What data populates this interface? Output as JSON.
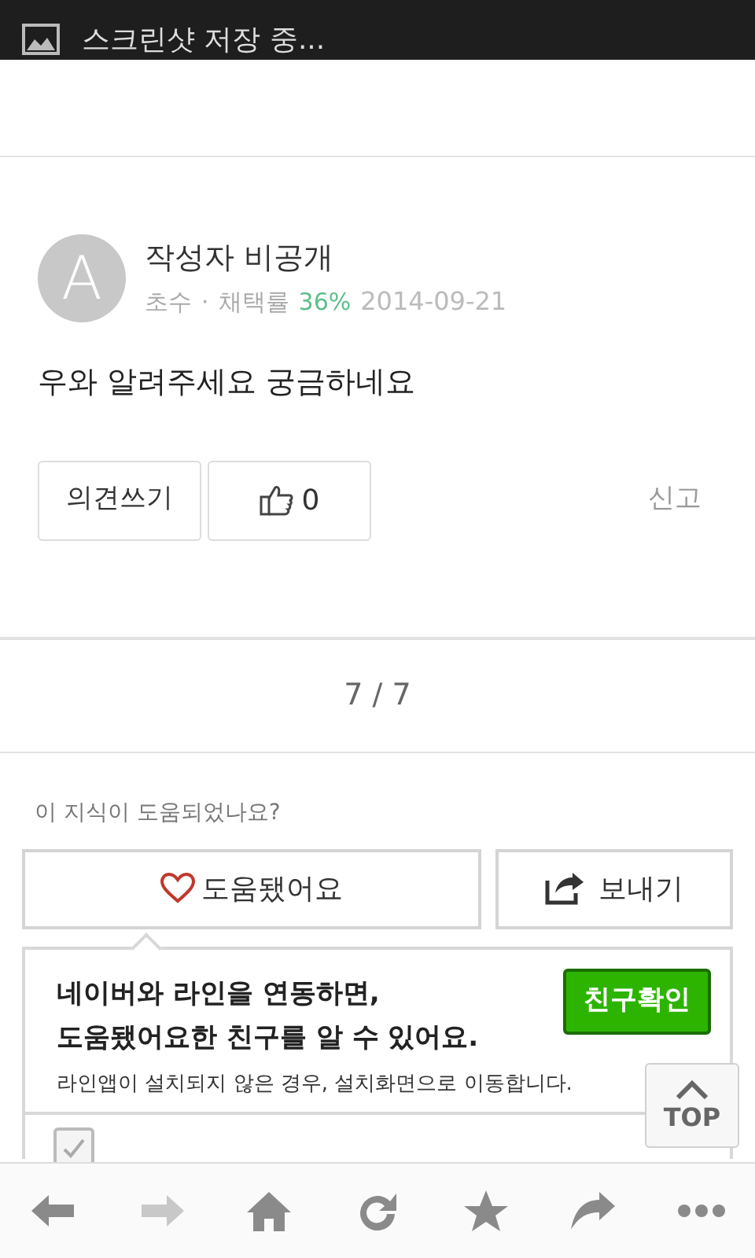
{
  "status_bar": {
    "notification": "스크린샷 저장 중..."
  },
  "answer": {
    "avatar_letter": "A",
    "author": "작성자 비공개",
    "rank": "초수",
    "separator": "·",
    "rate_label": "채택률",
    "rate": "36%",
    "date": "2014-09-21",
    "body": "우와 알려주세요 궁금하네요",
    "comment_button": "의견쓰기",
    "like_count": "0",
    "report": "신고"
  },
  "pager": "7 / 7",
  "feedback": {
    "question": "이 지식이 도움되었나요?",
    "helpful_button": "도움됐어요",
    "share_button": "보내기"
  },
  "popup": {
    "line_1": "네이버와 라인을 연동하면,",
    "line_2": "도움됐어요한 친구를 알 수 있어요.",
    "note": "라인앱이 설치되지 않은 경우, 설치화면으로 이동합니다.",
    "friend_button": "친구확인",
    "checkbox_checked": true
  },
  "top_button": "TOP",
  "toolbar": [
    {
      "kind": "back",
      "disabled": false
    },
    {
      "kind": "forward",
      "disabled": true
    },
    {
      "kind": "home",
      "disabled": false
    },
    {
      "kind": "reload",
      "disabled": false
    },
    {
      "kind": "bookmark",
      "disabled": false
    },
    {
      "kind": "share",
      "disabled": false
    },
    {
      "kind": "more",
      "disabled": false
    }
  ]
}
